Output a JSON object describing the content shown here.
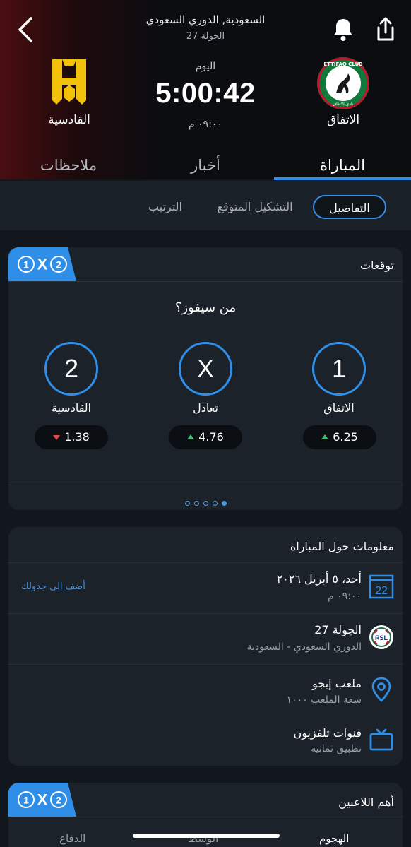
{
  "header": {
    "league": "السعودية, الدوري السعودي",
    "round": "الجولة 27",
    "day_label": "اليوم",
    "countdown": "5:00:42",
    "kick_time": "٠٩:٠٠ م",
    "home_team": "الاتفاق",
    "away_team": "القادسية",
    "home_logo_text": "ETTIFAQ CLUB",
    "home_logo_year": "1945"
  },
  "tabs": [
    {
      "label": "المباراة",
      "active": true
    },
    {
      "label": "أخبار",
      "active": false
    },
    {
      "label": "ملاحظات",
      "active": false
    }
  ],
  "subtabs": [
    {
      "label": "التفاصيل",
      "active": true
    },
    {
      "label": "التشكيل المتوقع",
      "active": false
    },
    {
      "label": "الترتيب",
      "active": false
    }
  ],
  "predictions": {
    "title": "توقعات",
    "badge": {
      "one": "1",
      "x": "X",
      "two": "2"
    },
    "question": "من سيفوز؟",
    "choices": [
      {
        "symbol": "1",
        "label": "الاتفاق",
        "odds": "6.25",
        "trend": "up"
      },
      {
        "symbol": "X",
        "label": "تعادل",
        "odds": "4.76",
        "trend": "up"
      },
      {
        "symbol": "2",
        "label": "القادسية",
        "odds": "1.38",
        "trend": "down"
      }
    ],
    "pager": {
      "count": 5,
      "active": 4
    }
  },
  "match_info": {
    "title": "معلومات حول المباراة",
    "date": "أحد، ٥ أبريل ٢٠٢٦",
    "time": "٠٩:٠٠ م",
    "calendar_day": "22",
    "add_to_calendar": "أضف إلى جدولك",
    "round": "الجولة 27",
    "competition": "الدوري السعودي - السعودية",
    "league_logo_text": "RSL",
    "venue": "ملعب إيجو",
    "capacity": "سعة الملعب ١٠٠٠",
    "tv_title": "قنوات تلفزيون",
    "tv_channel": "تطبيق ثمانية"
  },
  "top_players": {
    "title": "أهم اللاعبين",
    "tabs": [
      "الهجوم",
      "الوسط",
      "الدفاع"
    ]
  },
  "colors": {
    "accent": "#2f8fe8",
    "up": "#3ec46d",
    "down": "#e2474f",
    "card": "#1c2229"
  }
}
